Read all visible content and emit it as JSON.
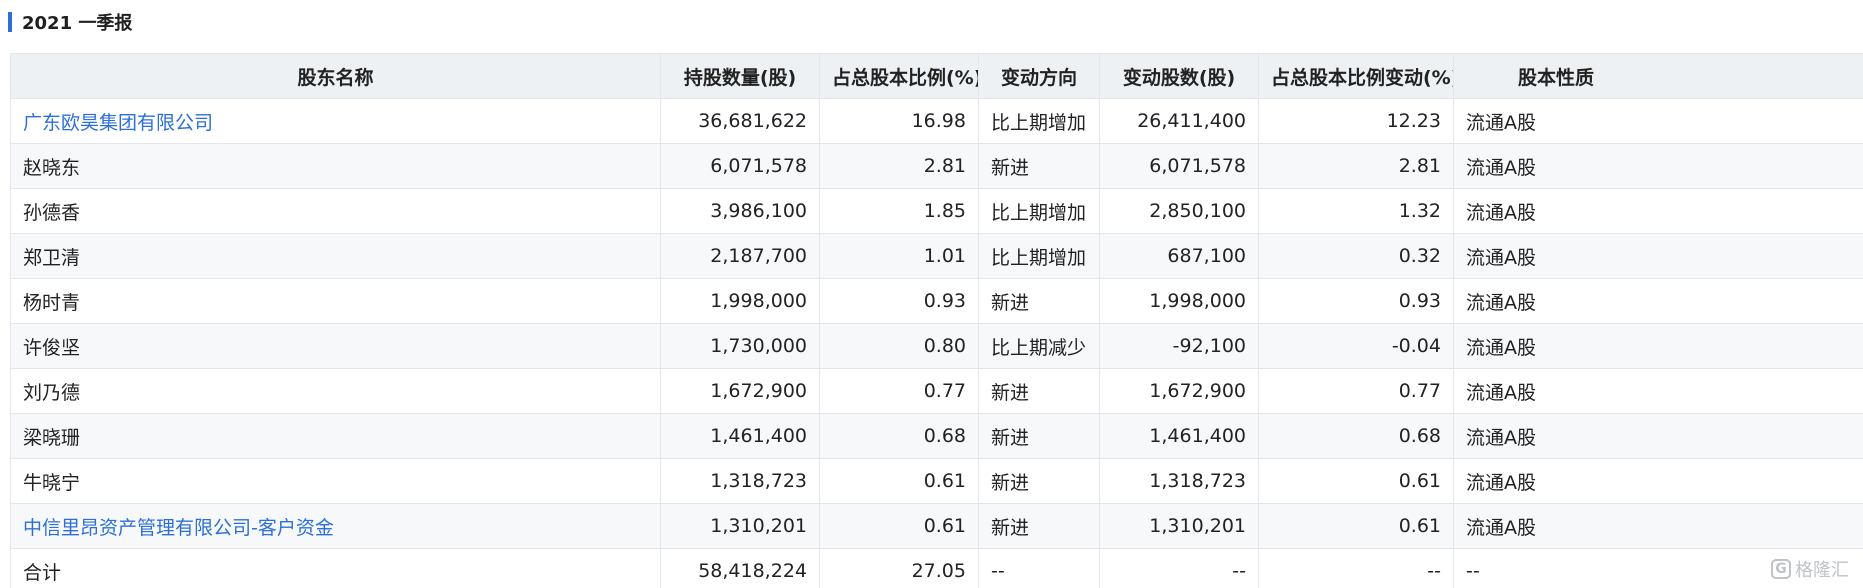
{
  "section": {
    "title": "2021 一季报"
  },
  "table": {
    "headers": [
      "股东名称",
      "持股数量(股)",
      "占总股本比例(%)",
      "变动方向",
      "变动股数(股)",
      "占总股本比例变动(%)",
      "股本性质"
    ],
    "rows": [
      {
        "name": "广东欧昊集团有限公司",
        "shares": "36,681,622",
        "ratio": "16.98",
        "direction": "比上期增加",
        "change_shares": "26,411,400",
        "ratio_change": "12.23",
        "nature": "流通A股"
      },
      {
        "name": "赵晓东",
        "shares": "6,071,578",
        "ratio": "2.81",
        "direction": "新进",
        "change_shares": "6,071,578",
        "ratio_change": "2.81",
        "nature": "流通A股"
      },
      {
        "name": "孙德香",
        "shares": "3,986,100",
        "ratio": "1.85",
        "direction": "比上期增加",
        "change_shares": "2,850,100",
        "ratio_change": "1.32",
        "nature": "流通A股"
      },
      {
        "name": "郑卫清",
        "shares": "2,187,700",
        "ratio": "1.01",
        "direction": "比上期增加",
        "change_shares": "687,100",
        "ratio_change": "0.32",
        "nature": "流通A股"
      },
      {
        "name": "杨时青",
        "shares": "1,998,000",
        "ratio": "0.93",
        "direction": "新进",
        "change_shares": "1,998,000",
        "ratio_change": "0.93",
        "nature": "流通A股"
      },
      {
        "name": "许俊坚",
        "shares": "1,730,000",
        "ratio": "0.80",
        "direction": "比上期减少",
        "change_shares": "-92,100",
        "ratio_change": "-0.04",
        "nature": "流通A股"
      },
      {
        "name": "刘乃德",
        "shares": "1,672,900",
        "ratio": "0.77",
        "direction": "新进",
        "change_shares": "1,672,900",
        "ratio_change": "0.77",
        "nature": "流通A股"
      },
      {
        "name": "梁晓珊",
        "shares": "1,461,400",
        "ratio": "0.68",
        "direction": "新进",
        "change_shares": "1,461,400",
        "ratio_change": "0.68",
        "nature": "流通A股"
      },
      {
        "name": "牛晓宁",
        "shares": "1,318,723",
        "ratio": "0.61",
        "direction": "新进",
        "change_shares": "1,318,723",
        "ratio_change": "0.61",
        "nature": "流通A股"
      },
      {
        "name": "中信里昂资产管理有限公司-客户资金",
        "shares": "1,310,201",
        "ratio": "0.61",
        "direction": "新进",
        "change_shares": "1,310,201",
        "ratio_change": "0.61",
        "nature": "流通A股"
      }
    ],
    "total": {
      "name": "合计",
      "shares": "58,418,224",
      "ratio": "27.05",
      "direction": "--",
      "change_shares": "--",
      "ratio_change": "--",
      "nature": "--"
    }
  },
  "watermark": {
    "icon": "G",
    "text": "格隆汇"
  },
  "colors": {
    "accent": "#2d6fd6",
    "link": "#2d6fd6",
    "header_bg": "#eef1f4",
    "row_alt_bg": "#f7f8fa",
    "border": "#e3e6ea"
  }
}
